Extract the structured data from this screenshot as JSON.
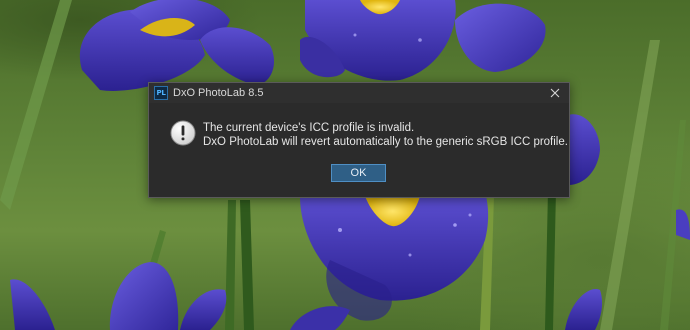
{
  "dialog": {
    "app_icon_text": "PL",
    "title": "DxO PhotoLab 8.5",
    "message_line1": "The current device's ICC profile is invalid.",
    "message_line2": "DxO PhotoLab will revert automatically to the generic sRGB ICC profile.",
    "ok_label": "OK"
  },
  "icons": {
    "app": "photolab-app-icon",
    "close": "close-icon",
    "message": "exclamation-icon"
  },
  "colors": {
    "dialog_background": "#2b2b2b",
    "button_accent": "#2f5f86",
    "button_border": "#4f8fc4",
    "iris_petal": "#3b2fa8",
    "iris_yellow": "#f2d21b"
  }
}
